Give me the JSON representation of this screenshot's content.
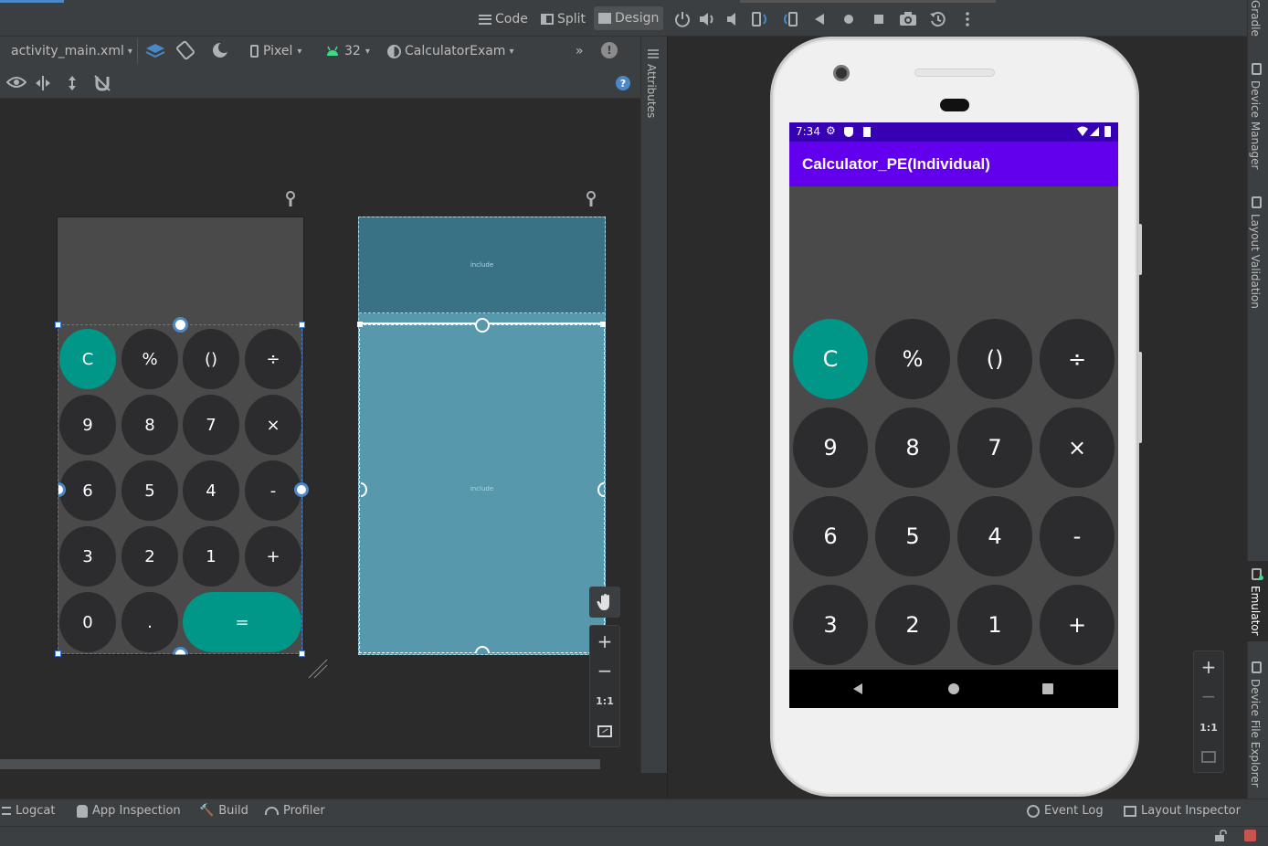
{
  "view_modes": {
    "code": "Code",
    "split": "Split",
    "design": "Design"
  },
  "design_toolbar": {
    "file": "activity_main.xml",
    "device": "Pixel",
    "api_level": "32",
    "theme": "CalculatorExam",
    "more": "»"
  },
  "attributes_tab": "Attributes",
  "blueprint": {
    "include_top": "include",
    "include_bottom": "include"
  },
  "calculator": {
    "rows": [
      [
        "C",
        "%",
        "()",
        "÷"
      ],
      [
        "9",
        "8",
        "7",
        "×"
      ],
      [
        "6",
        "5",
        "4",
        "-"
      ],
      [
        "3",
        "2",
        "1",
        "+"
      ]
    ],
    "last_row": [
      "0",
      ".",
      "="
    ]
  },
  "zoom_controls": {
    "plus": "+",
    "minus": "−",
    "one_to_one": "1:1"
  },
  "emulator": {
    "status_time": "7:34",
    "app_title": "Calculator_PE(Individual)"
  },
  "right_tabs": {
    "gradle": "Gradle",
    "device_manager": "Device Manager",
    "layout_validation": "Layout Validation",
    "emulator": "Emulator",
    "device_file_explorer": "Device File Explorer"
  },
  "bottom_tabs": {
    "logcat": "Logcat",
    "app_inspection": "App Inspection",
    "build": "Build",
    "profiler": "Profiler",
    "event_log": "Event Log",
    "layout_inspector": "Layout Inspector"
  },
  "colors": {
    "teal": "#009688",
    "purple_bar": "#6200ee",
    "status_bar": "#3700b3"
  }
}
